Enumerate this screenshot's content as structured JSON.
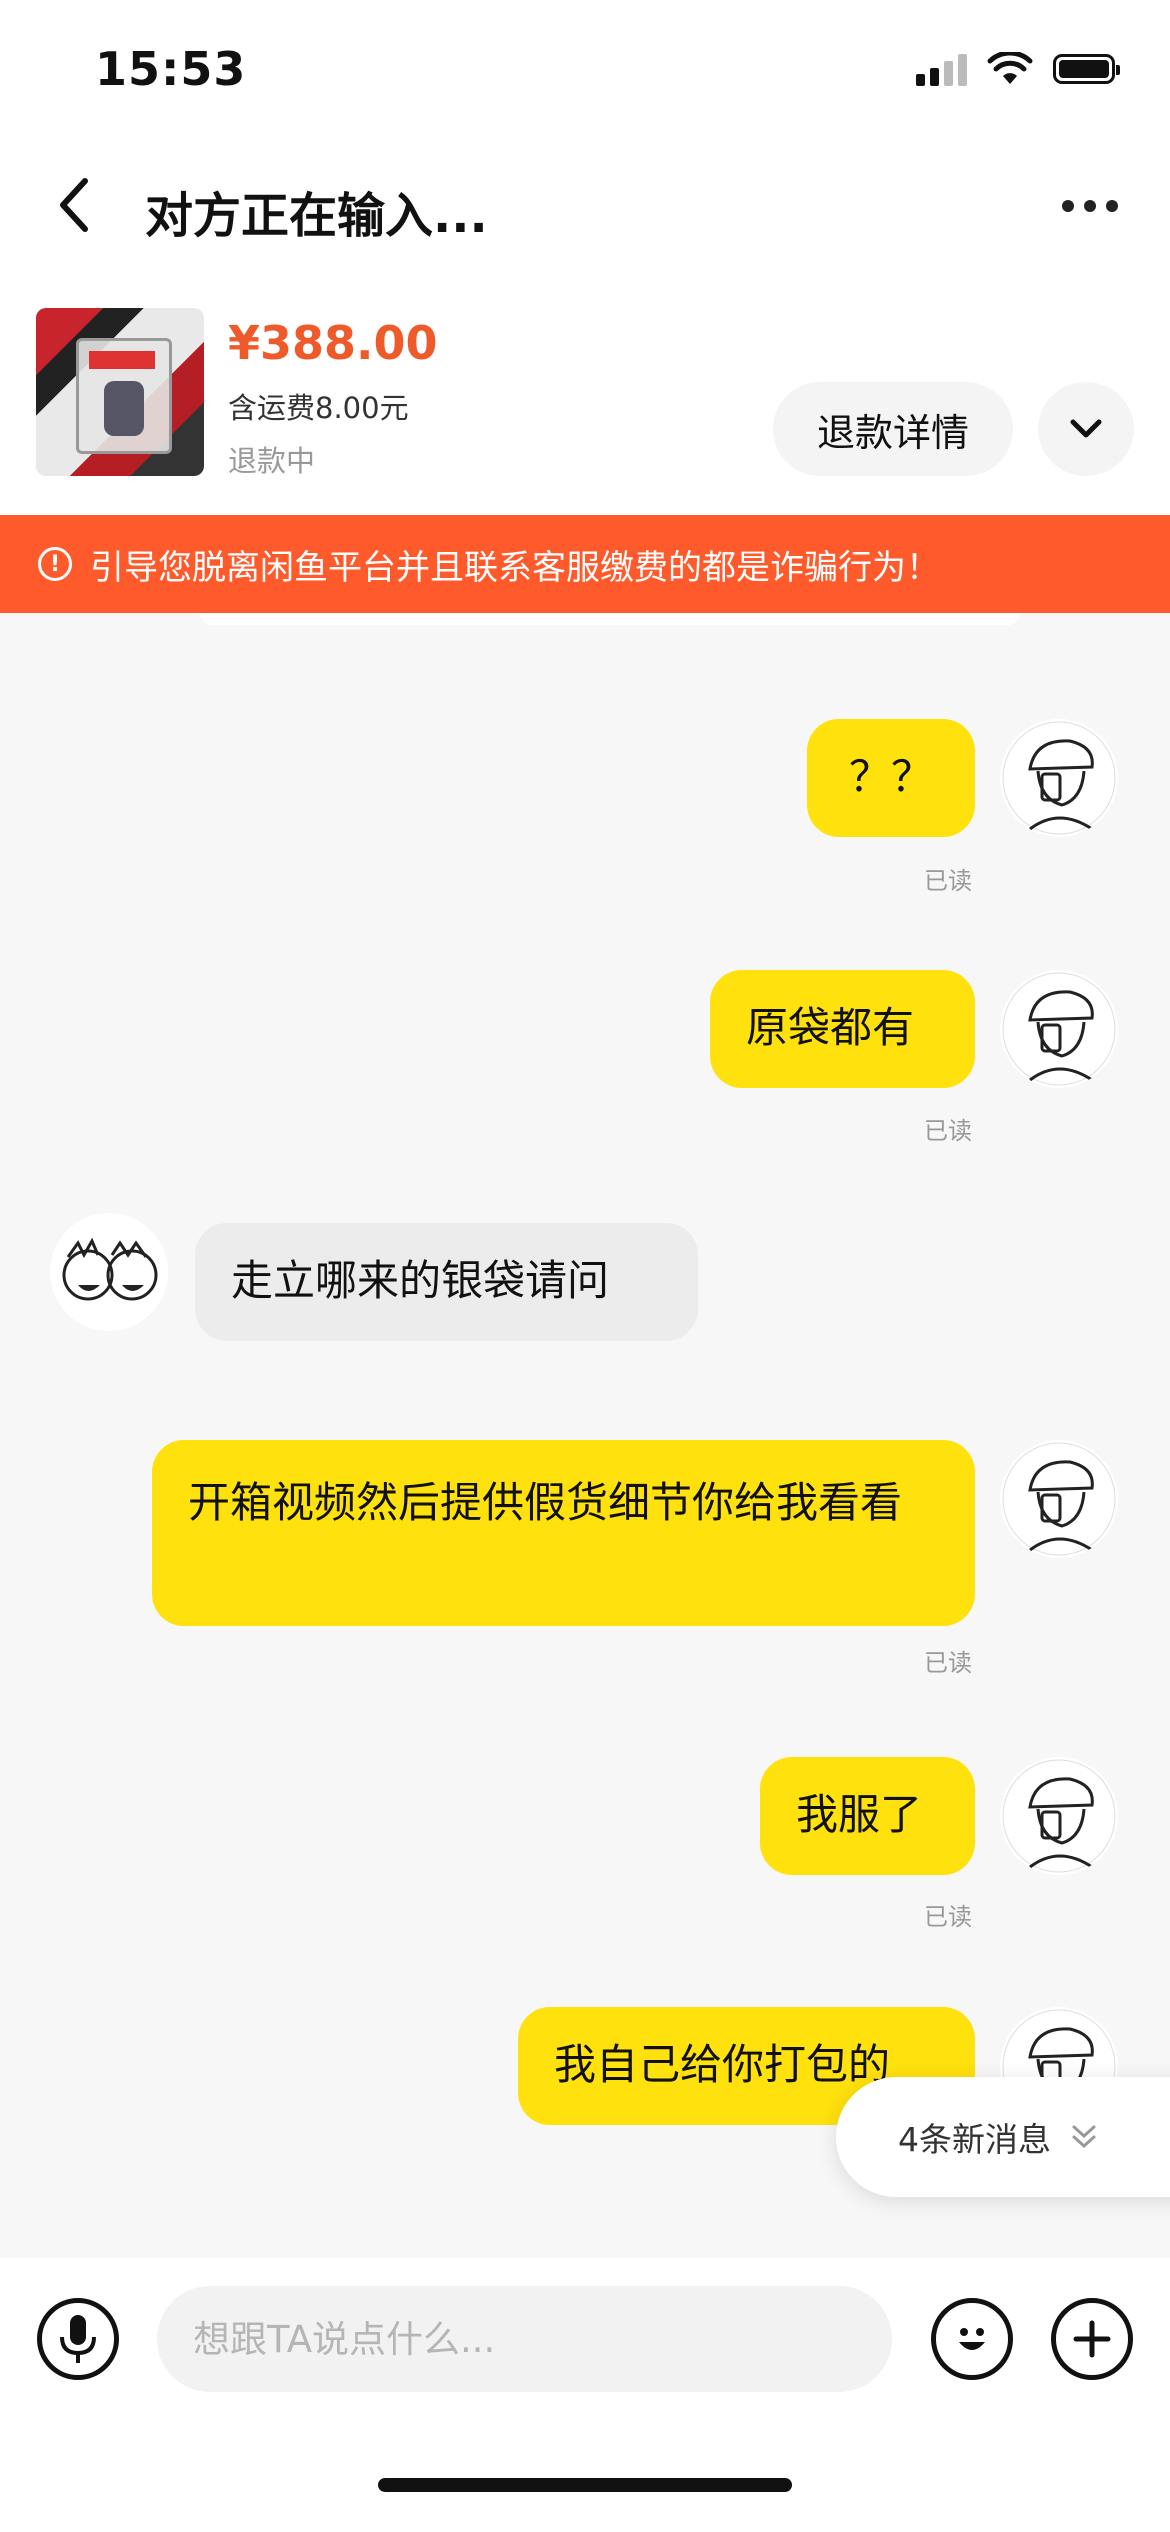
{
  "status_bar": {
    "time": "15:53"
  },
  "nav": {
    "title": "对方正在输入..."
  },
  "product": {
    "price": "¥388.00",
    "shipping": "含运费8.00元",
    "status": "退款中",
    "refund_button": "退款详情"
  },
  "warning": {
    "icon": "!",
    "text": "引导您脱离闲鱼平台并且联系客服缴费的都是诈骗行为！"
  },
  "messages": [
    {
      "side": "me",
      "text": "？？",
      "read": "已读"
    },
    {
      "side": "me",
      "text": "原袋都有",
      "read": "已读"
    },
    {
      "side": "them",
      "text": "走立哪来的银袋请问"
    },
    {
      "side": "me",
      "text": "开箱视频然后提供假货细节你给我看看",
      "read": "已读"
    },
    {
      "side": "me",
      "text": "我服了",
      "read": "已读"
    },
    {
      "side": "me",
      "text": "我自己给你打包的"
    }
  ],
  "new_messages": "4条新消息",
  "input": {
    "placeholder": "想跟TA说点什么..."
  },
  "colors": {
    "accent": "#ff5a2c",
    "price": "#ef5a2a",
    "my_bubble": "#ffe10e",
    "their_bubble": "#ececec"
  },
  "icons": [
    "back-arrow-icon",
    "more-icon",
    "chevron-down-icon",
    "warning-icon",
    "microphone-icon",
    "emoji-icon",
    "plus-icon",
    "double-chevron-down-icon"
  ]
}
